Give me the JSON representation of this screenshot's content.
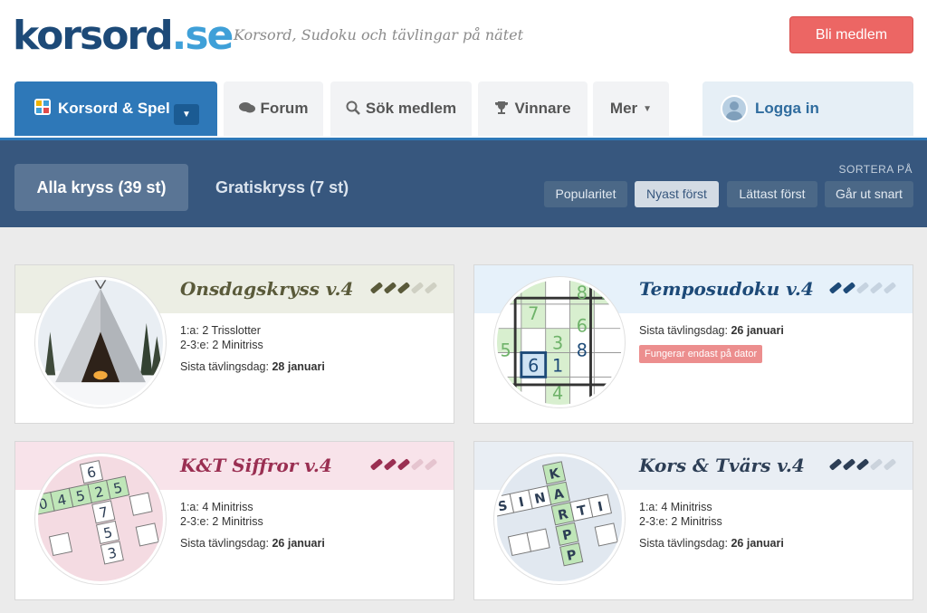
{
  "header": {
    "logo_main": "korsord",
    "logo_tld": ".se",
    "tagline": "Korsord, Sudoku och tävlingar på nätet",
    "join_label": "Bli medlem"
  },
  "nav": {
    "tabs": [
      {
        "label": "Korsord & Spel",
        "icon": "puzzle-icon"
      },
      {
        "label": "Forum",
        "icon": "comments-icon"
      },
      {
        "label": "Sök medlem",
        "icon": "search-icon"
      },
      {
        "label": "Vinnare",
        "icon": "trophy-icon"
      },
      {
        "label": "Mer",
        "icon": "chevron-down-icon"
      }
    ],
    "login_label": "Logga in"
  },
  "filters": {
    "all_label": "Alla kryss (39 st)",
    "free_label": "Gratiskryss (7 st)",
    "sort_label": "SORTERA PÅ",
    "sort_options": [
      "Popularitet",
      "Nyast först",
      "Lättast först",
      "Går ut snart"
    ],
    "sort_selected": "Nyast först"
  },
  "cards": [
    {
      "title": "Onsdagskryss v.4",
      "prize1": "1:a: 2 Trisslotter",
      "prize2": "2-3:e: 2 Minitriss",
      "deadline_label": "Sista tävlingsdag:",
      "deadline_date": "28 januari",
      "difficulty": 3,
      "theme_color": "#5a5a3a"
    },
    {
      "title": "Temposudoku v.4",
      "deadline_label": "Sista tävlingsdag:",
      "deadline_date": "26 januari",
      "warning": "Fungerar endast på dator",
      "difficulty": 2,
      "theme_color": "#1d4a78"
    },
    {
      "title": "K&T Siffror v.4",
      "prize1": "1:a: 4 Minitriss",
      "prize2": "2-3:e: 2 Minitriss",
      "deadline_label": "Sista tävlingsdag:",
      "deadline_date": "26 januari",
      "difficulty": 3,
      "theme_color": "#9a2f52"
    },
    {
      "title": "Kors & Tvärs v.4",
      "prize1": "1:a: 4 Minitriss",
      "prize2": "2-3:e: 2 Minitriss",
      "deadline_label": "Sista tävlingsdag:",
      "deadline_date": "26 januari",
      "difficulty": 3,
      "theme_color": "#2d3e55"
    }
  ],
  "puzzle_digits": {
    "sudoku": [
      "8",
      "5",
      "7",
      "6",
      "3",
      "8",
      "5",
      "6",
      "1",
      "5",
      "4"
    ],
    "numbers": [
      "6",
      "0",
      "4",
      "5",
      "2",
      "5",
      "7",
      "5",
      "3"
    ],
    "letters": [
      "K",
      "S",
      "I",
      "N",
      "A",
      "R",
      "T",
      "I",
      "P",
      "P"
    ]
  }
}
